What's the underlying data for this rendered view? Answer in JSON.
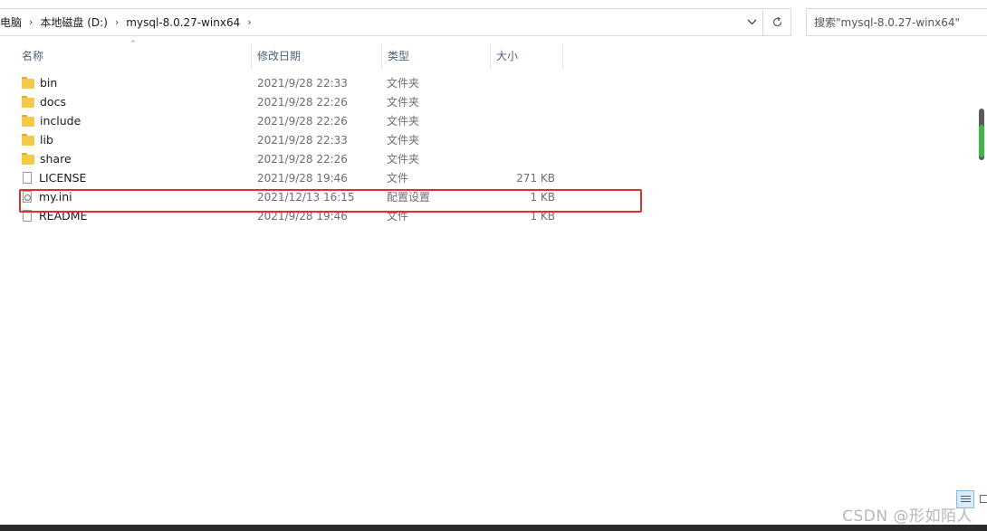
{
  "breadcrumb": {
    "items": [
      "此电脑",
      "本地磁盘 (D:)",
      "mysql-8.0.27-winx64"
    ]
  },
  "search": {
    "placeholder": "搜索\"mysql-8.0.27-winx64\""
  },
  "columns": {
    "name": "名称",
    "date": "修改日期",
    "type": "类型",
    "size": "大小"
  },
  "files": [
    {
      "name": "bin",
      "date": "2021/9/28 22:33",
      "type": "文件夹",
      "size": "",
      "icon": "folder-icon"
    },
    {
      "name": "docs",
      "date": "2021/9/28 22:26",
      "type": "文件夹",
      "size": "",
      "icon": "folder-icon"
    },
    {
      "name": "include",
      "date": "2021/9/28 22:26",
      "type": "文件夹",
      "size": "",
      "icon": "folder-icon"
    },
    {
      "name": "lib",
      "date": "2021/9/28 22:33",
      "type": "文件夹",
      "size": "",
      "icon": "folder-icon"
    },
    {
      "name": "share",
      "date": "2021/9/28 22:26",
      "type": "文件夹",
      "size": "",
      "icon": "folder-icon"
    },
    {
      "name": "LICENSE",
      "date": "2021/9/28 19:46",
      "type": "文件",
      "size": "271 KB",
      "icon": "file-icon"
    },
    {
      "name": "my.ini",
      "date": "2021/12/13 16:15",
      "type": "配置设置",
      "size": "1 KB",
      "icon": "config-file-icon"
    },
    {
      "name": "README",
      "date": "2021/9/28 19:46",
      "type": "文件",
      "size": "1 KB",
      "icon": "file-icon"
    }
  ],
  "watermark": "CSDN @形如陌人",
  "colors": {
    "highlight": "#e0302a",
    "folder": "#f5c94a",
    "header_text": "#4c607a"
  }
}
